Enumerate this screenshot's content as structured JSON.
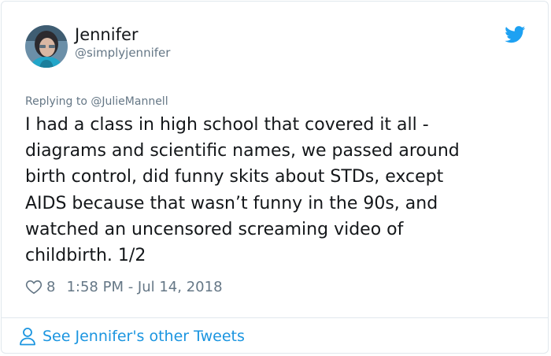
{
  "author": {
    "name": "Jennifer",
    "handle": "@simplyjennifer"
  },
  "reply": {
    "prefix": "Replying to ",
    "to": "@JulieMannell"
  },
  "tweet": {
    "lines": [
      "I had a class in high school that covered it all -",
      "diagrams and scientific names, we passed around",
      "birth control, did funny skits about STDs, except",
      "AIDS because that wasn’t funny in the 90s, and",
      "watched an uncensored screaming video of",
      "childbirth. 1/2"
    ]
  },
  "meta": {
    "likes": "8",
    "timestamp": "1:58 PM - Jul 14, 2018"
  },
  "footer": {
    "see_more": "See Jennifer's other Tweets"
  },
  "colors": {
    "twitter_blue": "#1da1f2",
    "link_blue": "#1b95e0",
    "text": "#14171a",
    "secondary": "#657786",
    "border": "#e1e8ed"
  },
  "icons": [
    "avatar",
    "twitter-bird-icon",
    "heart-icon",
    "person-icon"
  ]
}
